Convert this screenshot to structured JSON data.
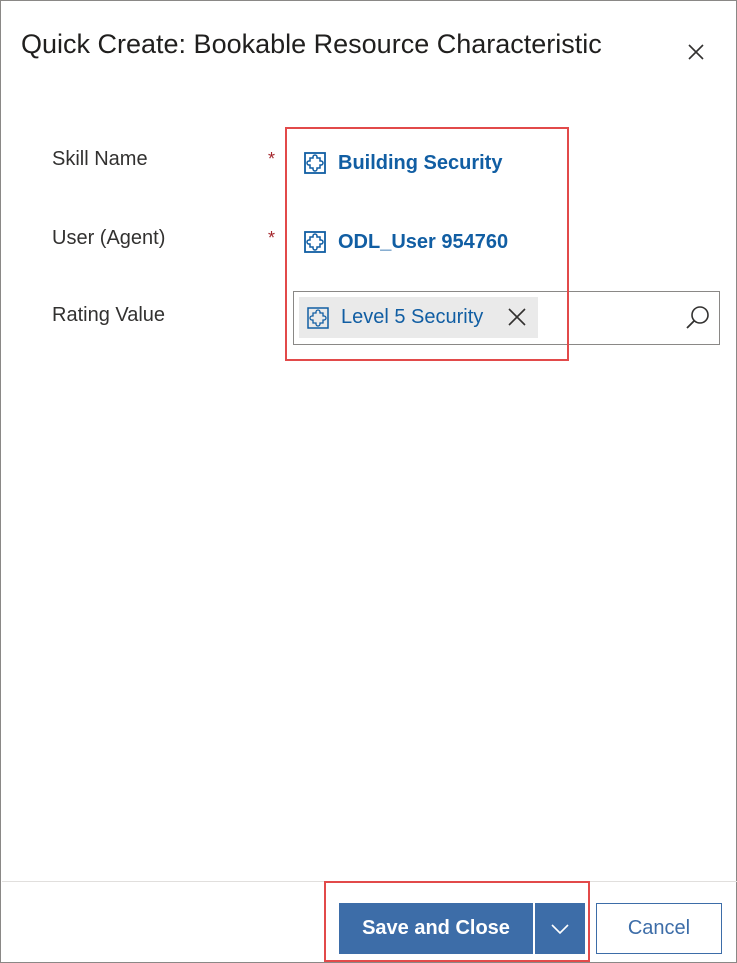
{
  "dialog": {
    "title": "Quick Create: Bookable Resource Characteristic",
    "close_icon": "close-icon"
  },
  "fields": {
    "skill": {
      "label": "Skill Name",
      "required_mark": "*",
      "value": "Building Security",
      "icon": "entity-puzzle-icon"
    },
    "user": {
      "label": "User (Agent)",
      "required_mark": "*",
      "value": "ODL_User 954760",
      "icon": "entity-puzzle-icon"
    },
    "rating": {
      "label": "Rating Value",
      "value": "Level 5 Security",
      "icon": "entity-puzzle-icon",
      "remove_icon": "close-icon",
      "search_icon": "search-icon"
    }
  },
  "footer": {
    "save_label": "Save and Close",
    "dropdown_icon": "chevron-down-icon",
    "cancel_label": "Cancel"
  },
  "colors": {
    "link": "#115ea3",
    "primary_button": "#3d6da8",
    "required": "#a4262c",
    "highlight": "#e24a4a"
  }
}
